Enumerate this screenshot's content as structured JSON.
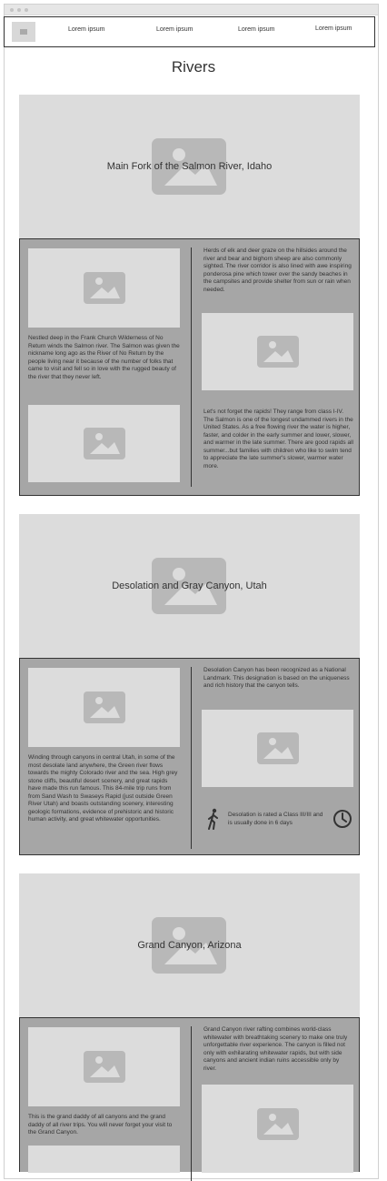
{
  "nav": {
    "links": [
      "Lorem ipsum",
      "Lorem ipsum",
      "Lorem ipsum",
      "Lorem ipsum"
    ]
  },
  "page": {
    "title": "Rivers"
  },
  "rivers": [
    {
      "caption": "Main Fork of the Salmon River, Idaho",
      "left_text": "Nestled deep in the Frank Church Wilderness of No Return winds the Salmon river. The Salmon was given the nickname long ago as the River of No Return by the people living near it because of the number of folks that came to visit and fell so in love with the rugged beauty of the river that they never left.",
      "right_text_1": "Herds of elk and deer graze on the hillsides around the river and bear and bighorn sheep are also commonly sighted. The river corridor is also lined with awe inspiring ponderosa pine which tower over the sandy beaches in the campsites and provide shelter from sun or rain when needed.",
      "right_text_2": "Let's not forget the rapids! They range from class I-IV. The Salmon is one of the longest undammed rivers in the United States. As a free flowing river the water is higher, faster, and colder in the early summer and lower, slower, and warmer in the late summer. There are good rapids all summer...but families with children who like to swim tend to appreciate the late summer's slower, warmer water more."
    },
    {
      "caption": "Desolation and Gray Canyon, Utah",
      "left_text": "Winding through canyons in central Utah, in some of the most desolate land anywhere, the Green river flows towards the mighty Colorado river and the sea. High grey stone cliffs, beautiful desert scenery, and great rapids have made this run famous. This 84-mile trip runs from from Sand Wash to Swaseys Rapid (just outside Green River Utah) and boasts outstanding scenery, interesting geologic formations, evidence of prehistoric and historic human activity, and great whitewater opportunities.",
      "right_text_1": "Desolation Canyon has been recognized as a National Landmark. This designation is based on the uniqueness and rich history that the canyon tells.",
      "info_text": "Desolation is rated a Class III/III and is usually done in 6 days",
      "icons": [
        "walking-person-icon",
        "clock-icon"
      ]
    },
    {
      "caption": "Grand Canyon, Arizona",
      "left_text": "This is the grand daddy of all canyons and the grand daddy of all river trips. You will never forget your visit to the Grand Canyon.",
      "right_text_1": "Grand Canyon river rafting combines world-class whitewater with breathtaking scenery to make one truly unforgettable river experience. The canyon is filled not only with exhilarating whitewater rapids, but with side canyons and ancient indian ruins accessible only by river."
    }
  ],
  "colors": {
    "hero_bg": "#dcdcdc",
    "body_bg": "#a6a6a6",
    "placeholder_icon": "#b8b8b8"
  }
}
